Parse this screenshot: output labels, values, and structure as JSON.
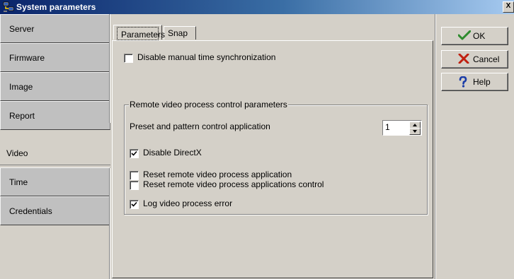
{
  "window": {
    "title": "System parameters",
    "close_label": "X"
  },
  "sidebar": {
    "items": [
      {
        "label": "Server"
      },
      {
        "label": "Firmware"
      },
      {
        "label": "Image"
      },
      {
        "label": "Report"
      },
      {
        "label": "Video",
        "active": true
      },
      {
        "label": "Time"
      },
      {
        "label": "Credentials"
      }
    ]
  },
  "tabs": [
    {
      "label": "Parameters",
      "selected": true
    },
    {
      "label": "Snap",
      "selected": false
    }
  ],
  "parameters": {
    "disable_time_sync": {
      "label": "Disable manual time synchronization",
      "checked": false
    },
    "group": {
      "title": "Remote video process control parameters",
      "preset_label": "Preset and pattern control application",
      "preset_value": "1",
      "disable_directx": {
        "label": "Disable DirectX",
        "checked": true
      },
      "reset_app": {
        "label": "Reset remote video process application",
        "checked": false
      },
      "reset_apps_control": {
        "label": "Reset remote video process applications control",
        "checked": false
      },
      "log_error": {
        "label": "Log video process error",
        "checked": true
      }
    }
  },
  "buttons": {
    "ok": "OK",
    "cancel": "Cancel",
    "help": "Help"
  },
  "colors": {
    "window_bg": "#d4d0c8",
    "titlebar_start": "#0a246a",
    "titlebar_end": "#a6caf0",
    "ok_icon": "#2e8b2e",
    "cancel_icon": "#c02010",
    "help_icon": "#1a3ca8"
  }
}
